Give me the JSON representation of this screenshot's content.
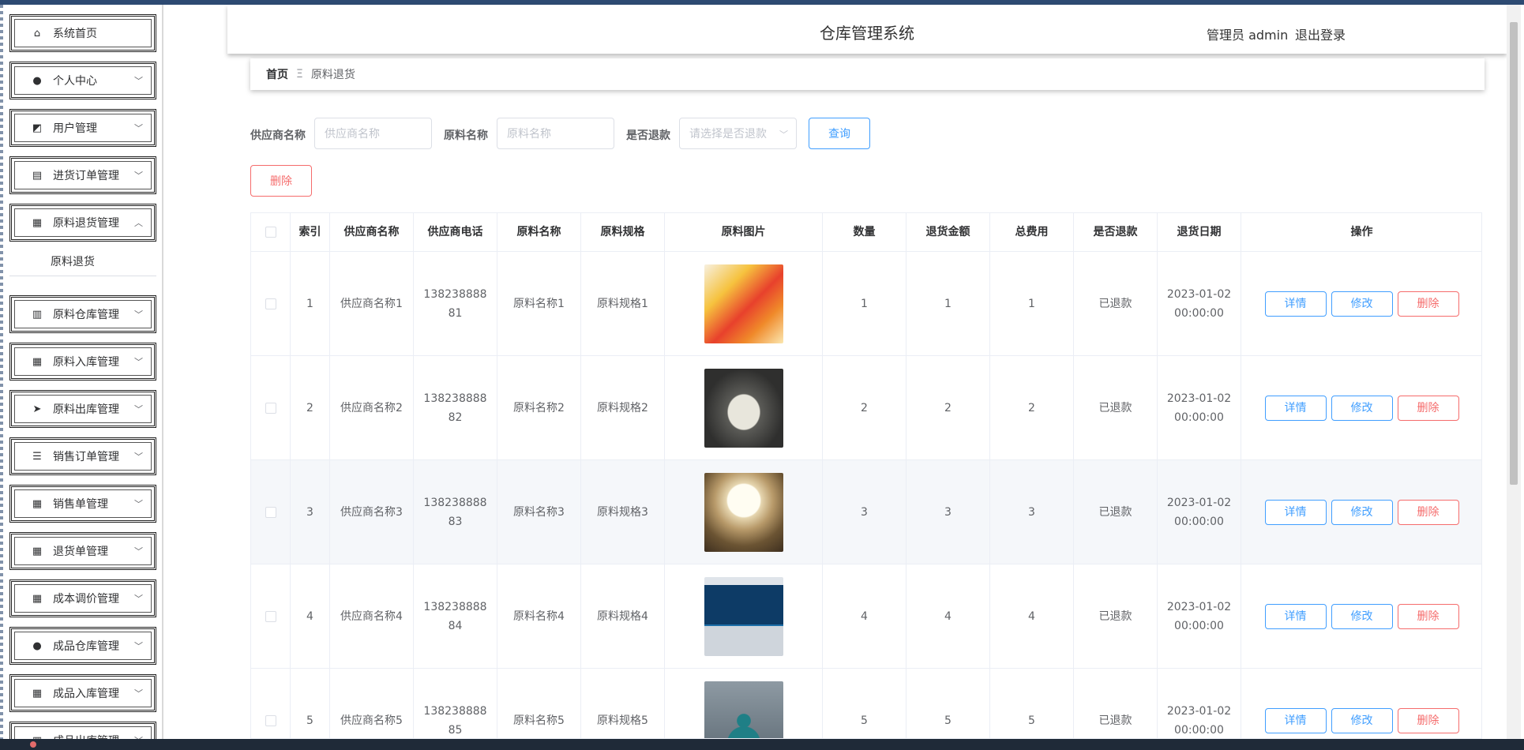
{
  "app": {
    "title": "仓库管理系统",
    "user": "管理员 admin",
    "logout": "退出登录"
  },
  "sidebar": {
    "items": [
      {
        "label": "系统首页",
        "icon": "home-icon",
        "glyph": "⌂",
        "chevron": ""
      },
      {
        "label": "个人中心",
        "icon": "user-icon",
        "glyph": "●",
        "chevron": "﹀"
      },
      {
        "label": "用户管理",
        "icon": "chart-line-icon",
        "glyph": "◩",
        "chevron": "﹀"
      },
      {
        "label": "进货订单管理",
        "icon": "clipboard-icon",
        "glyph": "▤",
        "chevron": "﹀"
      },
      {
        "label": "原料退货管理",
        "icon": "grid-icon",
        "glyph": "▦",
        "chevron": "︿"
      },
      {
        "label": "原料仓库管理",
        "icon": "bar-chart-icon",
        "glyph": "▥",
        "chevron": "﹀"
      },
      {
        "label": "原料入库管理",
        "icon": "grid-icon",
        "glyph": "▦",
        "chevron": "﹀"
      },
      {
        "label": "原料出库管理",
        "icon": "paper-plane-icon",
        "glyph": "➤",
        "chevron": "﹀"
      },
      {
        "label": "销售订单管理",
        "icon": "list-icon",
        "glyph": "☰",
        "chevron": "﹀"
      },
      {
        "label": "销售单管理",
        "icon": "grid-icon",
        "glyph": "▦",
        "chevron": "﹀"
      },
      {
        "label": "退货单管理",
        "icon": "grid-icon",
        "glyph": "▦",
        "chevron": "﹀"
      },
      {
        "label": "成本调价管理",
        "icon": "grid-icon",
        "glyph": "▦",
        "chevron": "﹀"
      },
      {
        "label": "成品仓库管理",
        "icon": "user-icon",
        "glyph": "●",
        "chevron": "﹀"
      },
      {
        "label": "成品入库管理",
        "icon": "grid-icon",
        "glyph": "▦",
        "chevron": "﹀"
      },
      {
        "label": "成品出库管理",
        "icon": "bar-chart-icon",
        "glyph": "▥",
        "chevron": "﹀"
      }
    ],
    "submenu": "原料退货"
  },
  "breadcrumb": {
    "home": "首页",
    "separator": "Ξ",
    "current": "原料退货"
  },
  "search": {
    "supplier_label": "供应商名称",
    "supplier_placeholder": "供应商名称",
    "material_label": "原料名称",
    "material_placeholder": "原料名称",
    "refund_label": "是否退款",
    "refund_placeholder": "请选择是否退款",
    "query_button": "查询"
  },
  "toolbar": {
    "delete_button": "删除"
  },
  "table": {
    "columns": [
      "索引",
      "供应商名称",
      "供应商电话",
      "原料名称",
      "原料规格",
      "原料图片",
      "数量",
      "退货金额",
      "总费用",
      "是否退款",
      "退货日期",
      "操作"
    ],
    "actions": {
      "detail": "详情",
      "edit": "修改",
      "delete": "删除"
    },
    "rows": [
      {
        "index": "1",
        "supplier": "供应商名称1",
        "phone": "13823888881",
        "material": "原料名称1",
        "spec": "原料规格1",
        "image": "jelly-snack-photo",
        "qty": "1",
        "amount": "1",
        "total": "1",
        "refunded": "已退款",
        "date": "2023-01-02 00:00:00"
      },
      {
        "index": "2",
        "supplier": "供应商名称2",
        "phone": "13823888882",
        "material": "原料名称2",
        "spec": "原料规格2",
        "image": "sneakers-photo",
        "qty": "2",
        "amount": "2",
        "total": "2",
        "refunded": "已退款",
        "date": "2023-01-02 00:00:00"
      },
      {
        "index": "3",
        "supplier": "供应商名称3",
        "phone": "13823888883",
        "material": "原料名称3",
        "spec": "原料规格3",
        "image": "ceiling-lamp-photo",
        "qty": "3",
        "amount": "3",
        "total": "3",
        "refunded": "已退款",
        "date": "2023-01-02 00:00:00"
      },
      {
        "index": "4",
        "supplier": "供应商名称4",
        "phone": "13823888884",
        "material": "原料名称4",
        "spec": "原料规格4",
        "image": "computer-monitor-photo",
        "qty": "4",
        "amount": "4",
        "total": "4",
        "refunded": "已退款",
        "date": "2023-01-02 00:00:00"
      },
      {
        "index": "5",
        "supplier": "供应商名称5",
        "phone": "13823888885",
        "material": "原料名称5",
        "spec": "原料规格5",
        "image": "gourd-vase-photo",
        "qty": "5",
        "amount": "5",
        "total": "5",
        "refunded": "已退款",
        "date": "2023-01-02 00:00:00"
      }
    ]
  }
}
